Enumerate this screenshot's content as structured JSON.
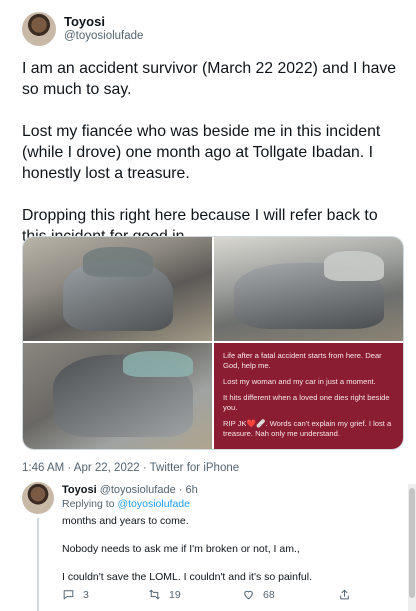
{
  "tweet": {
    "name": "Toyosi",
    "handle": "@toyosiolufade",
    "paragraphs": [
      "I am an accident survivor (March 22 2022) and I have so much to say.",
      "Lost my fiancée who was beside me in this incident (while I drove) one month ago at Tollgate Ibadan. I honestly lost a treasure.",
      "Dropping this right here because I will refer back to this incident for good in"
    ],
    "meta": "1:46 AM · Apr 22, 2022 · Twitter for iPhone",
    "image_card": {
      "lines": [
        "Life after a fatal accident starts from here. Dear God, help me.",
        "Lost my woman and my car in just a moment.",
        "It hits different when a loved one dies right beside you.",
        "RIP JK❤️🩹. Words can't explain my grief. I lost a treasure. Nah only me understand."
      ]
    }
  },
  "reply": {
    "name": "Toyosi",
    "handle_time": "@toyosiolufade · 6h",
    "replying_prefix": "Replying to",
    "replying_to": "@toyosiolufade",
    "lines": [
      "months and years to come.",
      "Nobody needs to ask me if I'm broken or not, I am.,",
      "I couldn't save the LOML. I couldn't and it's so painful."
    ],
    "actions": {
      "replies": "3",
      "retweets": "19",
      "likes": "68"
    }
  },
  "colors": {
    "text": "#0f1419",
    "secondary": "#536471",
    "link": "#1d9bf0",
    "card_bg": "#8b1d33"
  },
  "icons": [
    "reply-icon",
    "retweet-icon",
    "like-icon",
    "share-icon"
  ]
}
